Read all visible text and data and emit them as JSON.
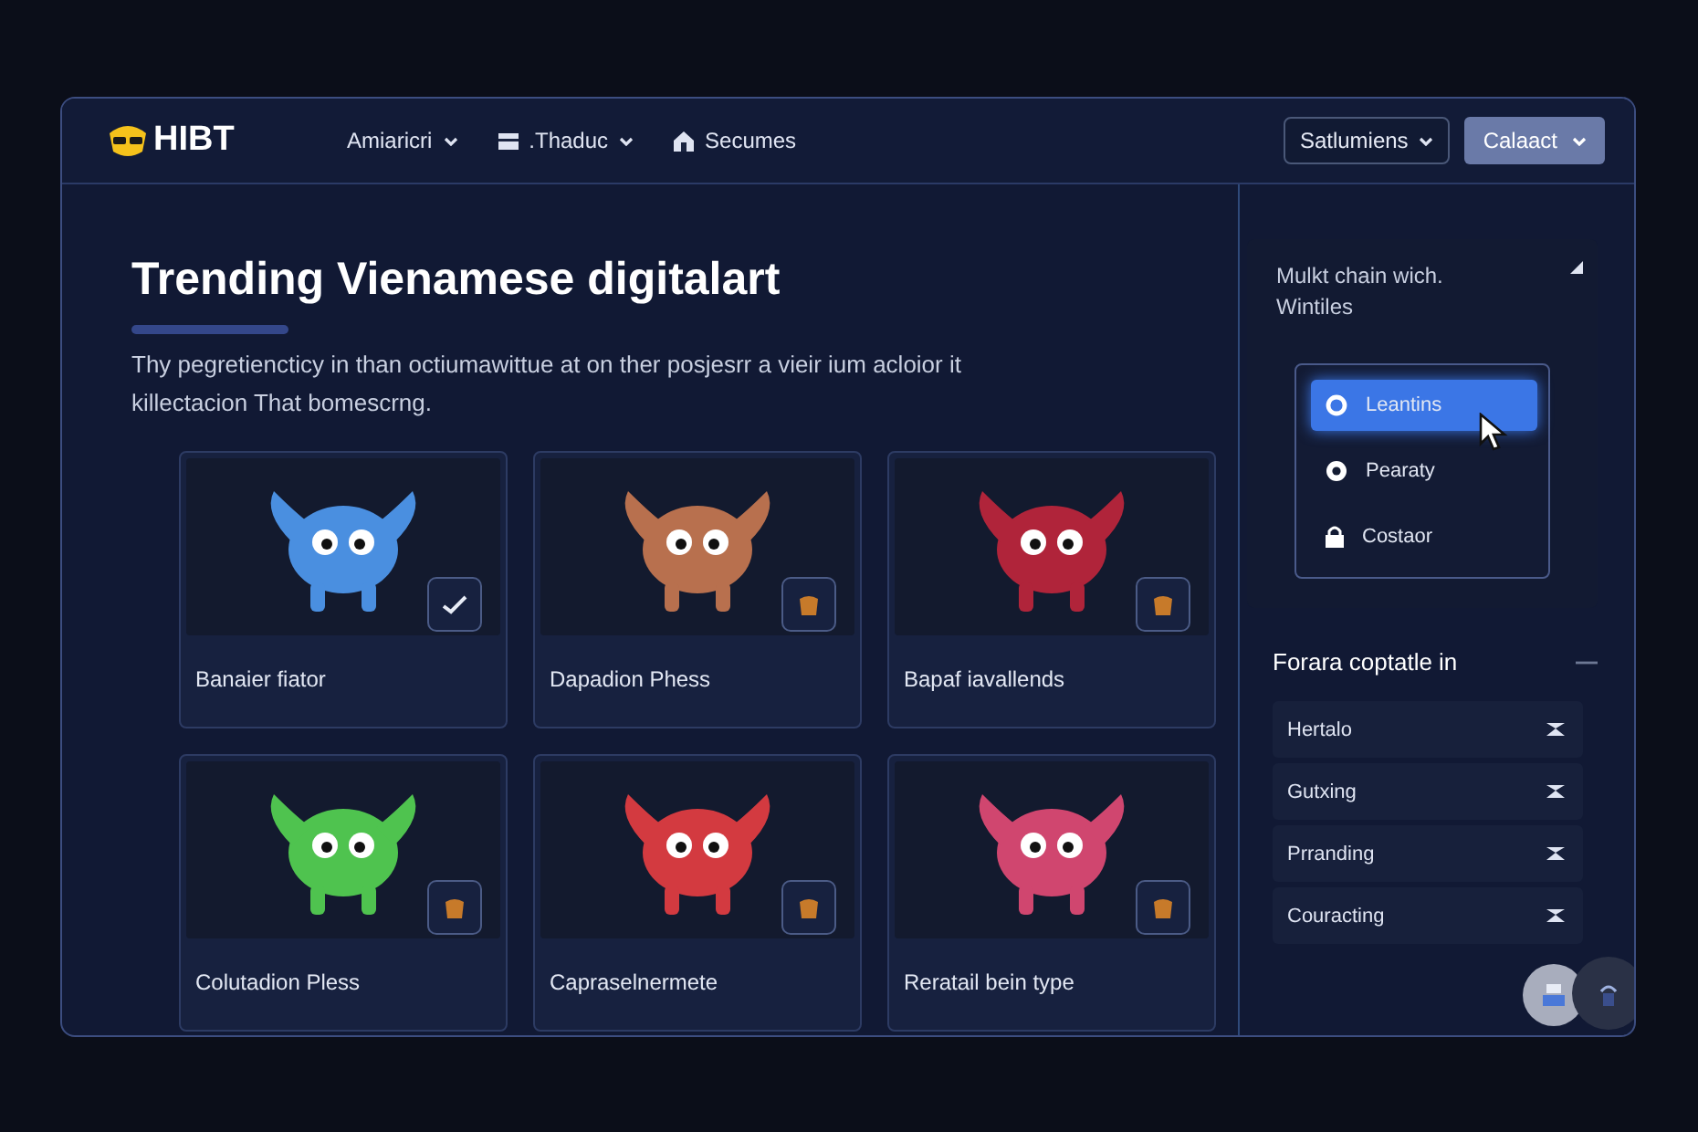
{
  "header": {
    "logo": "HIBT",
    "nav": [
      {
        "label": "Amiaricri"
      },
      {
        "label": ".Thaduc"
      },
      {
        "label": "Secumes"
      }
    ],
    "select": {
      "label": "Satlumiens"
    },
    "button": {
      "label": "Calaact"
    }
  },
  "main": {
    "title": "Trending Vienamese digitalart",
    "description": "Thy pegretiencticy in than octiumawittue at on ther posjesrr a vieir ium acloior it killectacion That bomescrng."
  },
  "cards": [
    {
      "title": "Banaier fiator",
      "color": "#4a8fe0",
      "checked": true
    },
    {
      "title": "Dapadion Phess",
      "color": "#b8704e",
      "checked": false
    },
    {
      "title": "Bapaf iavallends",
      "color": "#b0243a",
      "checked": false
    },
    {
      "title": "Colutadion Pless",
      "color": "#4fc34f",
      "checked": false
    },
    {
      "title": "Capraselnermete",
      "color": "#d33a40",
      "checked": false
    },
    {
      "title": "Reratail bein type",
      "color": "#d0466f",
      "checked": false
    }
  ],
  "sidebar": {
    "panel_title": "Mulkt chain wich. Wintiles",
    "menu": [
      {
        "label": "Leantins",
        "selected": true
      },
      {
        "label": "Pearaty",
        "selected": false
      },
      {
        "label": "Costaor",
        "selected": false
      }
    ],
    "list_title": "Forara coptatle in",
    "list": [
      {
        "label": "Hertalo"
      },
      {
        "label": "Gutxing"
      },
      {
        "label": "Prranding"
      },
      {
        "label": "Couracting"
      }
    ]
  }
}
